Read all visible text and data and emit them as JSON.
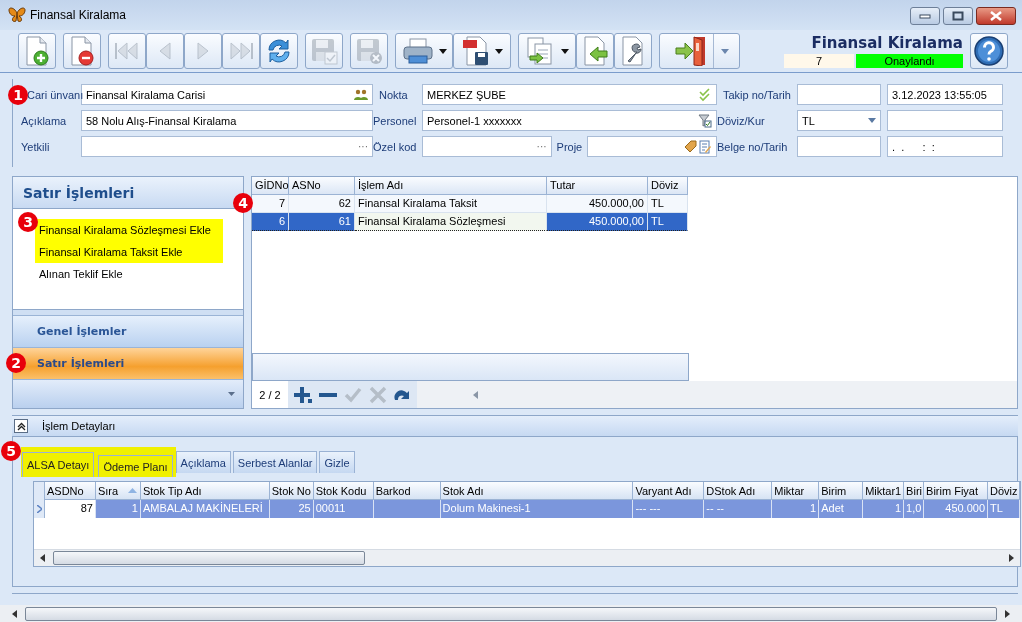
{
  "window": {
    "title": "Finansal Kiralama"
  },
  "toolbar": {
    "groups": [
      [
        {
          "kind": "plain",
          "disabled": false
        }
      ],
      [
        {
          "kind": "plain",
          "disabled": false
        }
      ],
      [
        {
          "kind": "plain",
          "disabled": true
        },
        {
          "kind": "plain",
          "disabled": true
        },
        {
          "kind": "plain",
          "disabled": true
        },
        {
          "kind": "plain",
          "disabled": true
        },
        {
          "kind": "plain",
          "disabled": false
        }
      ],
      [
        {
          "kind": "plain",
          "disabled": true
        }
      ],
      [
        {
          "kind": "plain",
          "disabled": true
        }
      ],
      [
        {
          "kind": "menu",
          "disabled": false
        },
        {
          "kind": "menu",
          "disabled": false
        }
      ],
      [
        {
          "kind": "menu",
          "disabled": false
        },
        {
          "kind": "plain",
          "disabled": false
        },
        {
          "kind": "plain",
          "disabled": false
        }
      ],
      [
        {
          "kind": "split",
          "disabled": false
        }
      ]
    ]
  },
  "document": {
    "title": "Finansal Kiralama",
    "number": "7",
    "status": "Onaylandı"
  },
  "form": {
    "rows": [
      [
        {
          "kind": "label",
          "text": "Cari ünvanı",
          "marker": "1"
        },
        {
          "kind": "people",
          "value": "Finansal Kiralama Carisi"
        },
        {
          "kind": "label",
          "text": "Nokta"
        },
        {
          "kind": "approved",
          "value": "MERKEZ ŞUBE"
        },
        {
          "kind": "label",
          "text": "Takip no/Tarih"
        },
        {
          "kind": "text"
        },
        {
          "kind": "text",
          "value": "3.12.2023 13:55:05"
        }
      ],
      [
        {
          "kind": "label",
          "text": "Açıklama"
        },
        {
          "kind": "text",
          "value": "58 Nolu Alış-Finansal Kiralama"
        },
        {
          "kind": "label",
          "text": "Personel"
        },
        {
          "kind": "filter",
          "value": "Personel-1 xxxxxxx"
        },
        {
          "kind": "label",
          "text": "Döviz/Kur"
        },
        {
          "kind": "dropdown",
          "value": "TL"
        },
        {
          "kind": "text"
        }
      ],
      [
        {
          "kind": "label",
          "text": "Yetkili"
        },
        {
          "kind": "text",
          "button_text": "···"
        },
        {
          "kind": "label",
          "text": "Özel kod"
        },
        {
          "kind": "group",
          "items": [
            {
              "kind": "text",
              "button_text": "···"
            },
            {
              "kind": "label",
              "text": "Proje"
            },
            {
              "kind": "tags"
            }
          ]
        },
        {
          "kind": "label",
          "text": "Belge no/Tarih"
        },
        {
          "kind": "text"
        },
        {
          "kind": "text",
          "value": ".  .      :  :"
        }
      ]
    ]
  },
  "nav": {
    "title": "Satır İşlemleri",
    "items": [
      {
        "text": "Finansal Kiralama Sözleşmesi Ekle",
        "highlighted": true,
        "marker": "3"
      },
      {
        "text": "Finansal Kiralama Taksit Ekle",
        "highlighted": true
      },
      {
        "text": "Alınan Teklif Ekle",
        "highlighted": false
      }
    ],
    "groups": [
      {
        "label": "Genel İşlemler",
        "selected": false
      },
      {
        "label": "Satır İşlemleri",
        "selected": true,
        "marker": "2"
      }
    ]
  },
  "grid": {
    "columns": [
      {
        "label": "GİDNo",
        "numeric": true
      },
      {
        "label": "ASNo",
        "numeric": true
      },
      {
        "label": "İşlem Adı",
        "numeric": false
      },
      {
        "label": "Tutar",
        "numeric": true
      },
      {
        "label": "Döviz",
        "numeric": false
      }
    ],
    "rows": [
      {
        "selected": false,
        "marker": "4",
        "cells": [
          "7",
          "62",
          "Finansal Kiralama Taksit",
          "450.000,00",
          "TL"
        ]
      },
      {
        "selected": true,
        "cells": [
          "6",
          "61",
          "Finansal Kiralama Sözleşmesi",
          "450.000,00",
          "TL"
        ]
      }
    ],
    "navigator": {
      "count": "2 / 2",
      "actions": [
        {
          "disabled": false
        },
        {
          "disabled": false
        },
        {
          "disabled": true
        },
        {
          "disabled": true
        },
        {
          "disabled": false
        }
      ]
    }
  },
  "details": {
    "title": "İşlem Detayları",
    "tabs": [
      {
        "label": "ALSA Detayı",
        "selected": true,
        "highlighted": true,
        "marker": "5"
      },
      {
        "label": "Ödeme Planı",
        "selected": false,
        "highlighted": true
      },
      {
        "label": "Açıklama",
        "selected": false,
        "highlighted": false
      },
      {
        "label": "Serbest Alanlar",
        "selected": false,
        "highlighted": false
      },
      {
        "label": "Gizle",
        "selected": false,
        "highlighted": false
      }
    ],
    "grid": {
      "columns": [
        {
          "label": "ASDNo",
          "numeric": true
        },
        {
          "label": "Sıra",
          "numeric": true,
          "sorted": true
        },
        {
          "label": "Stok Tip Adı",
          "numeric": false
        },
        {
          "label": "Stok No",
          "numeric": true
        },
        {
          "label": "Stok Kodu",
          "numeric": false
        },
        {
          "label": "Barkod"
        },
        {
          "label": "Stok Adı",
          "numeric": false
        },
        {
          "label": "Varyant Adı",
          "numeric": false
        },
        {
          "label": "DStok Adı",
          "numeric": false
        },
        {
          "label": "Miktar",
          "numeric": true
        },
        {
          "label": "Birim",
          "numeric": false
        },
        {
          "label": "Miktar1",
          "numeric": true
        },
        {
          "label": "Biri"
        },
        {
          "label": "Birim Fiyat",
          "numeric": true
        },
        {
          "label": "Döviz",
          "numeric": false
        }
      ],
      "rows": [
        {
          "selected": true,
          "cells": [
            "87",
            "1",
            "AMBALAJ MAKİNELERİ",
            "25",
            "00011",
            "",
            "Dolum Makinesi-1",
            "--- ---",
            "-- --",
            "1",
            "Adet",
            "1",
            "1,0",
            "450.000",
            "TL"
          ]
        }
      ]
    }
  }
}
